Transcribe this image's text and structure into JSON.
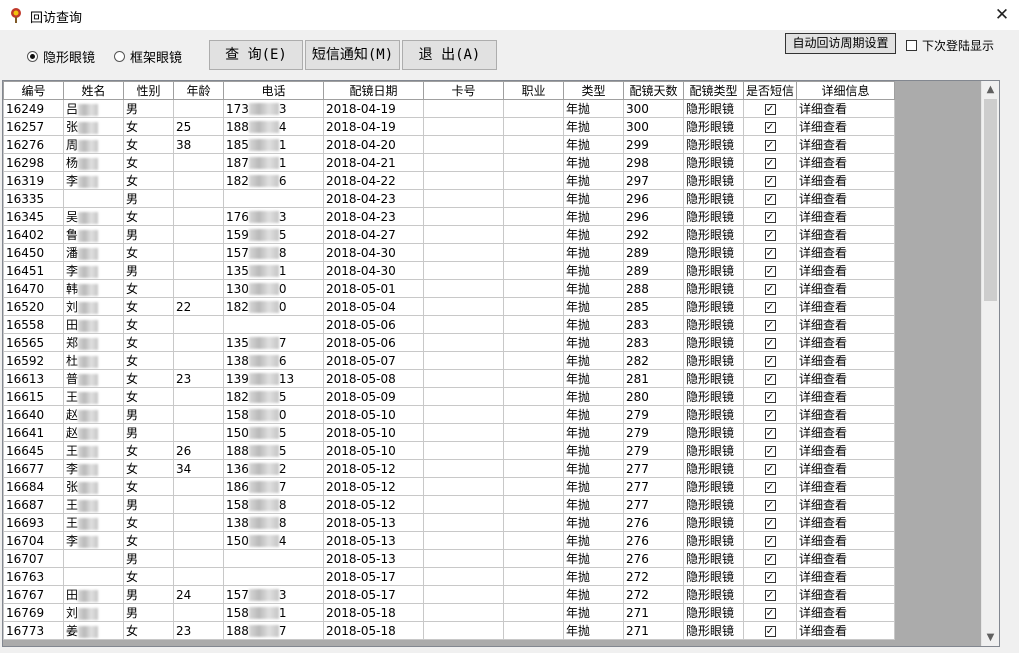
{
  "window": {
    "title": "回访查询"
  },
  "filters": {
    "radio_contact": "隐形眼镜",
    "radio_frame": "框架眼镜",
    "selected": "contact"
  },
  "toolbar": {
    "query": "查 询(E)",
    "sms": "短信通知(M)",
    "exit": "退 出(A)",
    "auto_period": "自动回访周期设置",
    "next_login": "下次登陆显示"
  },
  "table": {
    "headers": [
      "编号",
      "姓名",
      "性别",
      "年龄",
      "电话",
      "配镜日期",
      "卡号",
      "职业",
      "类型",
      "配镜天数",
      "配镜类型",
      "是否短信",
      "详细信息"
    ],
    "rows": [
      [
        "16249",
        "吕",
        "男",
        "",
        "173",
        "3",
        "2018-04-19",
        "年抛",
        "300"
      ],
      [
        "16257",
        "张",
        "女",
        "25",
        "188",
        "4",
        "2018-04-19",
        "年抛",
        "300"
      ],
      [
        "16276",
        "周",
        "女",
        "38",
        "185",
        "1",
        "2018-04-20",
        "年抛",
        "299"
      ],
      [
        "16298",
        "杨",
        "女",
        "",
        "187",
        "1",
        "2018-04-21",
        "年抛",
        "298"
      ],
      [
        "16319",
        "李",
        "女",
        "",
        "182",
        "6",
        "2018-04-22",
        "年抛",
        "297"
      ],
      [
        "16335",
        "",
        "男",
        "",
        "",
        "",
        "2018-04-23",
        "年抛",
        "296"
      ],
      [
        "16345",
        "吴",
        "女",
        "",
        "176",
        "3",
        "2018-04-23",
        "年抛",
        "296"
      ],
      [
        "16402",
        "鲁",
        "男",
        "",
        "159",
        "5",
        "2018-04-27",
        "年抛",
        "292"
      ],
      [
        "16450",
        "潘",
        "女",
        "",
        "157",
        "8",
        "2018-04-30",
        "年抛",
        "289"
      ],
      [
        "16451",
        "李",
        "男",
        "",
        "135",
        "1",
        "2018-04-30",
        "年抛",
        "289"
      ],
      [
        "16470",
        "韩",
        "女",
        "",
        "130",
        "0",
        "2018-05-01",
        "年抛",
        "288"
      ],
      [
        "16520",
        "刘",
        "女",
        "22",
        "182",
        "0",
        "2018-05-04",
        "年抛",
        "285"
      ],
      [
        "16558",
        "田",
        "女",
        "",
        "",
        "",
        "2018-05-06",
        "年抛",
        "283"
      ],
      [
        "16565",
        "郑",
        "女",
        "",
        "135",
        "7",
        "2018-05-06",
        "年抛",
        "283"
      ],
      [
        "16592",
        "杜",
        "女",
        "",
        "138",
        "6",
        "2018-05-07",
        "年抛",
        "282"
      ],
      [
        "16613",
        "普",
        "女",
        "23",
        "139",
        "13",
        "2018-05-08",
        "年抛",
        "281"
      ],
      [
        "16615",
        "王",
        "女",
        "",
        "182",
        "5",
        "2018-05-09",
        "年抛",
        "280"
      ],
      [
        "16640",
        "赵",
        "男",
        "",
        "158",
        "0",
        "2018-05-10",
        "年抛",
        "279"
      ],
      [
        "16641",
        "赵",
        "男",
        "",
        "150",
        "5",
        "2018-05-10",
        "年抛",
        "279"
      ],
      [
        "16645",
        "王",
        "女",
        "26",
        "188",
        "5",
        "2018-05-10",
        "年抛",
        "279"
      ],
      [
        "16677",
        "李",
        "女",
        "34",
        "136",
        "2",
        "2018-05-12",
        "年抛",
        "277"
      ],
      [
        "16684",
        "张",
        "女",
        "",
        "186",
        "7",
        "2018-05-12",
        "年抛",
        "277"
      ],
      [
        "16687",
        "王",
        "男",
        "",
        "158",
        "8",
        "2018-05-12",
        "年抛",
        "277"
      ],
      [
        "16693",
        "王",
        "女",
        "",
        "138",
        "8",
        "2018-05-13",
        "年抛",
        "276"
      ],
      [
        "16704",
        "李",
        "女",
        "",
        "150",
        "4",
        "2018-05-13",
        "年抛",
        "276"
      ],
      [
        "16707",
        "",
        "男",
        "",
        "",
        "",
        "2018-05-13",
        "年抛",
        "276"
      ],
      [
        "16763",
        "",
        "女",
        "",
        "",
        "",
        "2018-05-17",
        "年抛",
        "272"
      ],
      [
        "16767",
        "田",
        "男",
        "24",
        "157",
        "3",
        "2018-05-17",
        "年抛",
        "272"
      ],
      [
        "16769",
        "刘",
        "男",
        "",
        "158",
        "1",
        "2018-05-18",
        "年抛",
        "271"
      ],
      [
        "16773",
        "姜",
        "女",
        "23",
        "188",
        "7",
        "2018-05-18",
        "年抛",
        "271"
      ]
    ],
    "lens_type": "隐形眼镜",
    "detail_label": "详细查看",
    "sms_checked": "✓"
  }
}
